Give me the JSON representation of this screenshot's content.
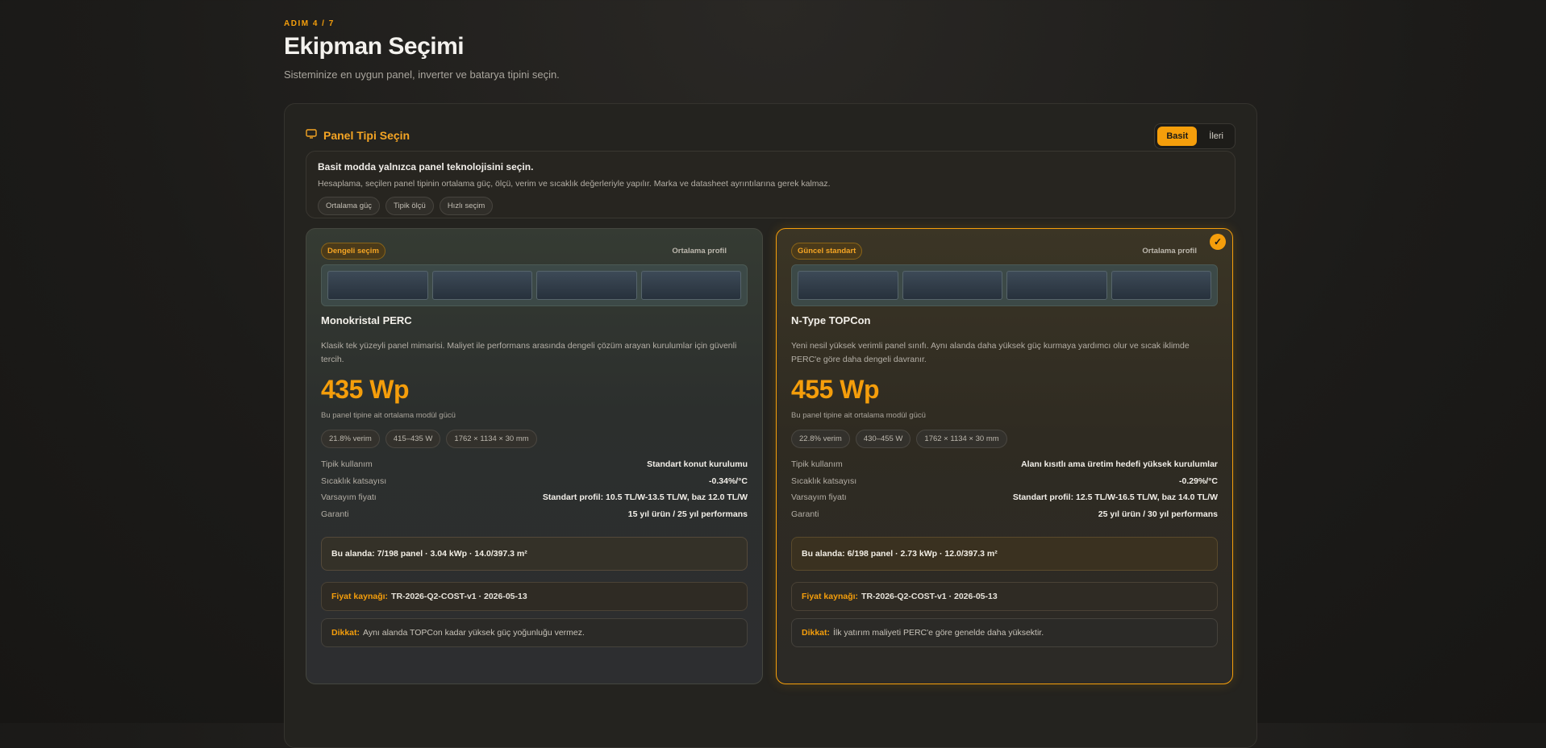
{
  "header": {
    "step": "ADIM 4 / 7",
    "title": "Ekipman Seçimi",
    "subtitle": "Sisteminize en uygun panel, inverter ve batarya tipini seçin."
  },
  "panel": {
    "title": "Panel Tipi Seçin",
    "icon": "monitor-icon",
    "modes": [
      {
        "label": "Basit",
        "active": true
      },
      {
        "label": "İleri",
        "active": false
      }
    ],
    "info": {
      "heading": "Basit modda yalnızca panel teknolojisini seçin.",
      "text": "Hesaplama, seçilen panel tipinin ortalama güç, ölçü, verim ve sıcaklık değerleriyle yapılır. Marka ve datasheet ayrıntılarına gerek kalmaz.",
      "chips": [
        "Ortalama güç",
        "Tipik ölçü",
        "Hızlı seçim"
      ]
    }
  },
  "cards": [
    {
      "badge": "Dengeli seçim",
      "profile": "Ortalama profil",
      "selected": false,
      "name": "Monokristal PERC",
      "description": "Klasik tek yüzeyli panel mimarisi. Maliyet ile performans arasında dengeli çözüm arayan kurulumlar için güvenli tercih.",
      "power": "435 Wp",
      "power_label": "Bu panel tipine ait ortalama modül gücü",
      "specs": [
        "21.8% verim",
        "415–435 W",
        "1762 × 1134 × 30 mm"
      ],
      "rows": [
        {
          "k": "Tipik kullanım",
          "v": "Standart konut kurulumu"
        },
        {
          "k": "Sıcaklık katsayısı",
          "v": "-0.34%/°C"
        },
        {
          "k": "Varsayım fiyatı",
          "v": "Standart profil: 10.5 TL/W-13.5 TL/W, baz 12.0 TL/W"
        },
        {
          "k": "Garanti",
          "v": "15 yıl ürün / 25 yıl performans"
        }
      ],
      "area": "Bu alanda: 7/198 panel · 3.04 kWp · 14.0/397.3 m²",
      "source_label": "Fiyat kaynağı:",
      "source": "TR-2026-Q2-COST-v1 · 2026-05-13",
      "warn_label": "Dikkat:",
      "warn": "Aynı alanda TOPCon kadar yüksek güç yoğunluğu vermez."
    },
    {
      "badge": "Güncel standart",
      "profile": "Ortalama profil",
      "selected": true,
      "check": "✓",
      "name": "N-Type TOPCon",
      "description": "Yeni nesil yüksek verimli panel sınıfı. Aynı alanda daha yüksek güç kurmaya yardımcı olur ve sıcak iklimde PERC'e göre daha dengeli davranır.",
      "power": "455 Wp",
      "power_label": "Bu panel tipine ait ortalama modül gücü",
      "specs": [
        "22.8% verim",
        "430–455 W",
        "1762 × 1134 × 30 mm"
      ],
      "rows": [
        {
          "k": "Tipik kullanım",
          "v": "Alanı kısıtlı ama üretim hedefi yüksek kurulumlar"
        },
        {
          "k": "Sıcaklık katsayısı",
          "v": "-0.29%/°C"
        },
        {
          "k": "Varsayım fiyatı",
          "v": "Standart profil: 12.5 TL/W-16.5 TL/W, baz 14.0 TL/W"
        },
        {
          "k": "Garanti",
          "v": "25 yıl ürün / 30 yıl performans"
        }
      ],
      "area": "Bu alanda: 6/198 panel · 2.73 kWp · 12.0/397.3 m²",
      "source_label": "Fiyat kaynağı:",
      "source": "TR-2026-Q2-COST-v1 · 2026-05-13",
      "warn_label": "Dikkat:",
      "warn": "İlk yatırım maliyeti PERC'e göre genelde daha yüksektir."
    }
  ]
}
